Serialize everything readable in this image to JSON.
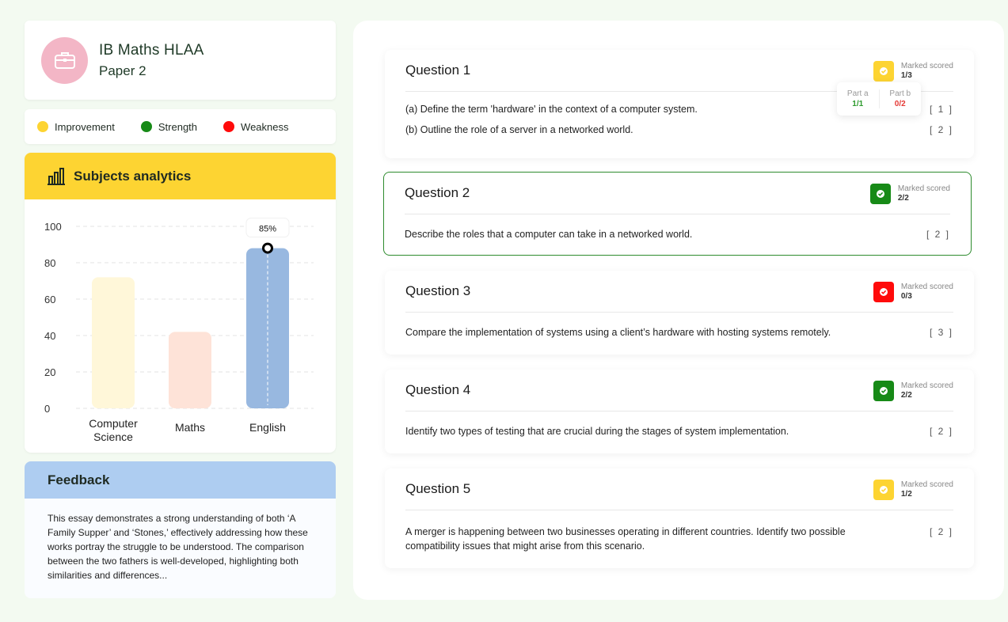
{
  "subject": {
    "icon": "briefcase-icon",
    "title": "IB Maths HLAA",
    "paper": "Paper 2",
    "icon_bg": "#f3b6c6"
  },
  "legend": [
    {
      "label": "Improvement",
      "color": "#fdd432"
    },
    {
      "label": "Strength",
      "color": "#178a17"
    },
    {
      "label": "Weakness",
      "color": "#ff0b0b"
    }
  ],
  "analytics": {
    "title": "Subjects analytics",
    "icon": "bar-chart-icon"
  },
  "chart_data": {
    "type": "bar",
    "categories": [
      "Computer Science",
      "Maths",
      "English"
    ],
    "category_lines": [
      [
        "Computer",
        "Science"
      ],
      [
        "Maths"
      ],
      [
        "English"
      ]
    ],
    "values": [
      72,
      42,
      88
    ],
    "colors": [
      "#fff7d9",
      "#fee3d8",
      "#98b8e0"
    ],
    "yticks": [
      0,
      20,
      40,
      60,
      80,
      100
    ],
    "ylim": [
      0,
      100
    ],
    "highlight": {
      "category": "English",
      "label": "85%"
    },
    "grid": true
  },
  "feedback": {
    "title": "Feedback",
    "text": "This essay demonstrates a strong understanding of both ‘A Family Supper’ and ‘Stones,’ effectively addressing how these works portray the struggle to be understood. The comparison between the two fathers is well-developed, highlighting both similarities and differences..."
  },
  "questions": [
    {
      "title": "Question 1",
      "score_label": "Marked scored",
      "score": "1/3",
      "status_color": "#fdd432",
      "lines": [
        {
          "text": "(a) Define the term 'hardware' in the context of a computer system.",
          "mark": "[ 1 ]"
        },
        {
          "text": "(b) Outline the role of a server in a networked world.",
          "mark": "[ 2 ]"
        }
      ],
      "parts": [
        {
          "label": "Part a",
          "score": "1/1",
          "color": "#2e9b2e"
        },
        {
          "label": "Part b",
          "score": "0/2",
          "color": "#e53935"
        }
      ]
    },
    {
      "title": "Question 2",
      "score_label": "Marked scored",
      "score": "2/2",
      "status_color": "#178a17",
      "lines": [
        {
          "text": "Describe the roles that a computer can take in a networked world.",
          "mark": "[ 2 ]"
        }
      ]
    },
    {
      "title": "Question 3",
      "score_label": "Marked scored",
      "score": "0/3",
      "status_color": "#ff0b0b",
      "lines": [
        {
          "text": "Compare the implementation of systems using a client’s hardware with hosting systems remotely.",
          "mark": "[ 3 ]"
        }
      ]
    },
    {
      "title": "Question 4",
      "score_label": "Marked scored",
      "score": "2/2",
      "status_color": "#178a17",
      "lines": [
        {
          "text": "Identify two types of testing that are crucial during the stages of system implementation.",
          "mark": "[ 2 ]"
        }
      ]
    },
    {
      "title": "Question 5",
      "score_label": "Marked scored",
      "score": "1/2",
      "status_color": "#fdd432",
      "lines": [
        {
          "text": "A merger is happening between two businesses operating in different countries. Identify two possible compatibility issues that might arise from this scenario.",
          "mark": "[ 2 ]"
        }
      ]
    }
  ]
}
